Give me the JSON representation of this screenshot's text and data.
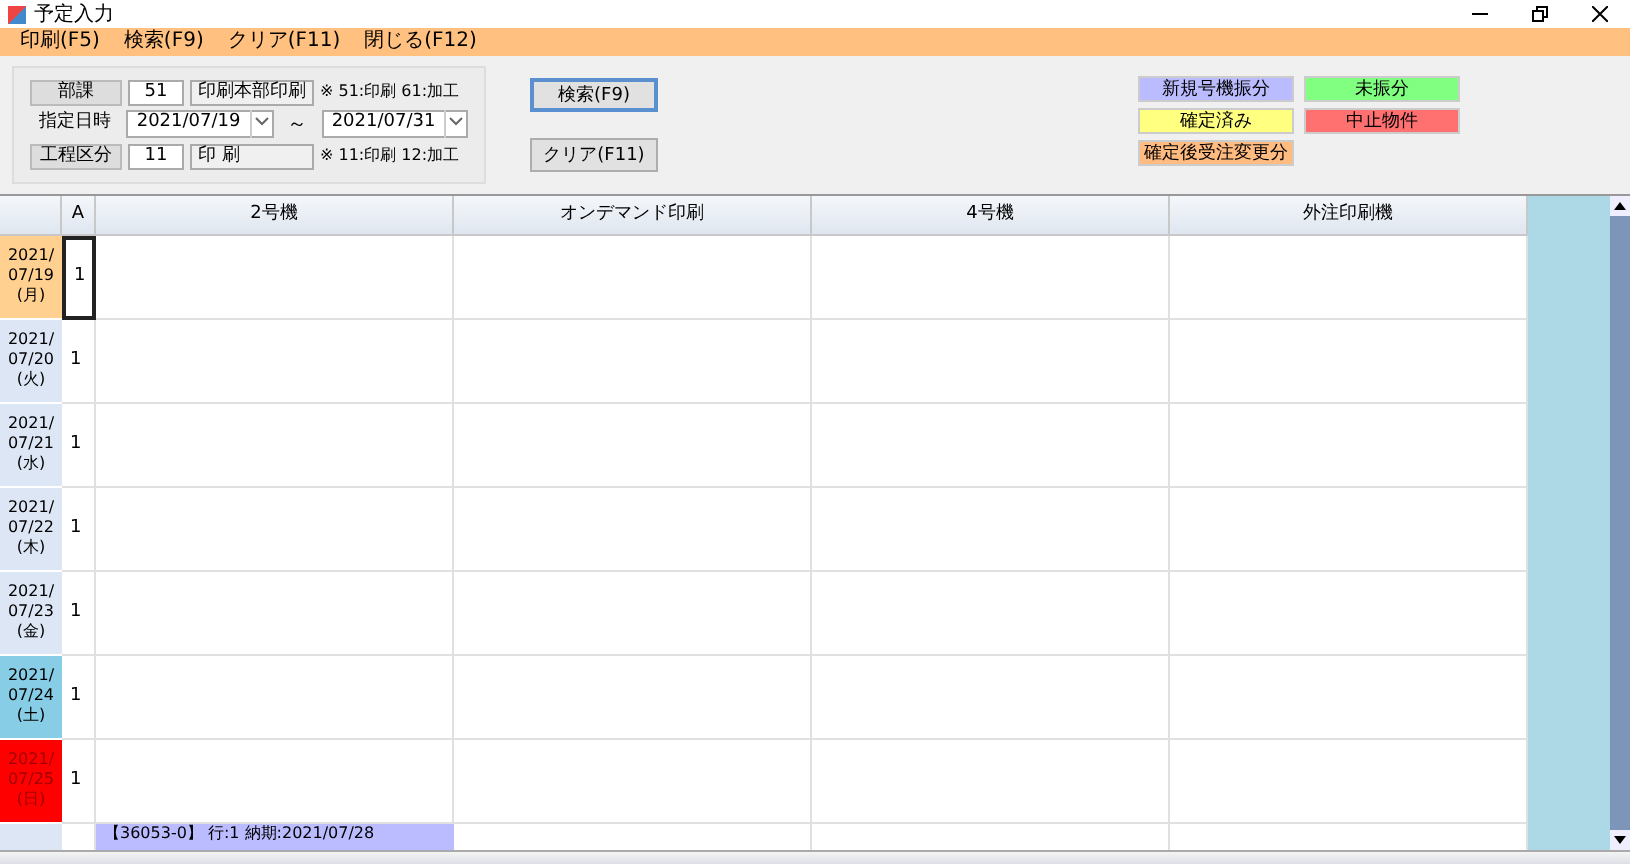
{
  "window": {
    "title": "予定入力"
  },
  "menu": [
    "印刷(F5)",
    "検索(F9)",
    "クリア(F11)",
    "閉じる(F12)"
  ],
  "filter": {
    "dept": {
      "label": "部課",
      "code": "51",
      "name": "印刷本部印刷",
      "note": "※ 51:印刷 61:加工"
    },
    "date": {
      "label": "指定日時",
      "from": "2021/07/19",
      "separator": "～",
      "to": "2021/07/31"
    },
    "process": {
      "label": "工程区分",
      "code": "11",
      "name": "印 刷",
      "note": "※ 11:印刷 12:加工"
    }
  },
  "buttons": [
    "検索(F9)",
    "クリア(F11)"
  ],
  "legend": [
    {
      "label": "新規号機振分",
      "color": "#bbbbff"
    },
    {
      "label": "未振分",
      "color": "#80ff80"
    },
    {
      "label": "確定済み",
      "color": "#ffff80"
    },
    {
      "label": "中止物件",
      "color": "#ff7070"
    },
    {
      "label": "確定後受注変更分",
      "color": "#ffbb80"
    }
  ],
  "table": {
    "columns": [
      "A",
      "2号機",
      "オンデマンド印刷",
      "4号機",
      "外注印刷機"
    ],
    "rows": [
      {
        "date": "2021/ 07/19 (月)",
        "color": "#ffd090",
        "a": "1",
        "selected": true
      },
      {
        "date": "2021/ 07/20 (火)",
        "color": "#dce6f4",
        "a": "1",
        "selected": false
      },
      {
        "date": "2021/ 07/21 (水)",
        "color": "#dce6f4",
        "a": "1",
        "selected": false
      },
      {
        "date": "2021/ 07/22 (木)",
        "color": "#dce6f4",
        "a": "1",
        "selected": false
      },
      {
        "date": "2021/ 07/23 (金)",
        "color": "#dce6f4",
        "a": "1",
        "selected": false
      },
      {
        "date": "2021/ 07/24 (土)",
        "color": "#87cde6",
        "a": "1",
        "selected": false
      },
      {
        "date": "2021/ 07/25 (日)",
        "color": "#ff0000",
        "a": "1",
        "selected": false
      }
    ],
    "entry": {
      "text": "【36053-0】 行:1 納期:2021/07/28",
      "color": "#bbbbff"
    }
  }
}
